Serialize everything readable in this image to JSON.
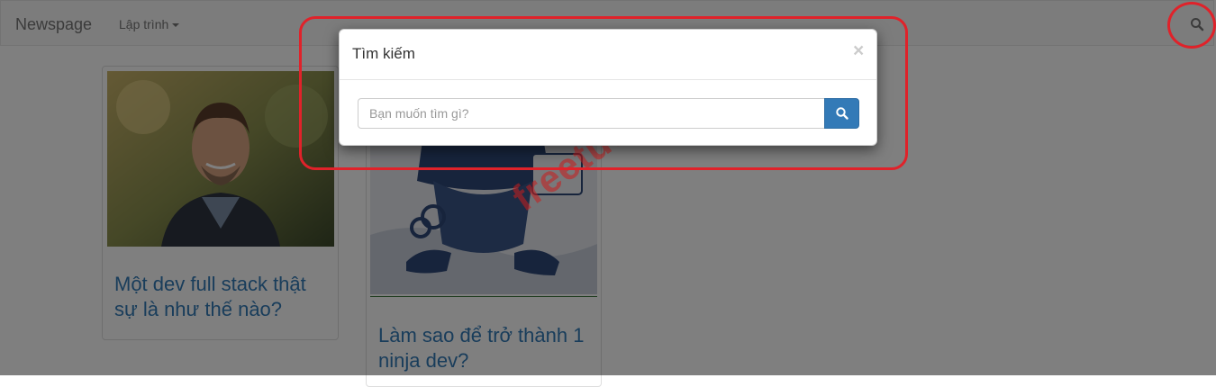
{
  "navbar": {
    "brand": "Newspage",
    "dropdown_label": "Lập trình",
    "search_icon": "search-icon"
  },
  "cards": [
    {
      "title": "Một dev full stack thật sự là như thế nào?"
    },
    {
      "title": "Làm sao để trở thành 1 ninja dev?"
    }
  ],
  "modal": {
    "title": "Tìm kiếm",
    "close_label": "×",
    "search_placeholder": "Bạn muốn tìm gì?",
    "search_button_icon": "search-icon"
  },
  "watermark": "freetuts.net",
  "colors": {
    "link": "#337ab7",
    "button": "#337ab7",
    "highlight": "#e0222a"
  }
}
